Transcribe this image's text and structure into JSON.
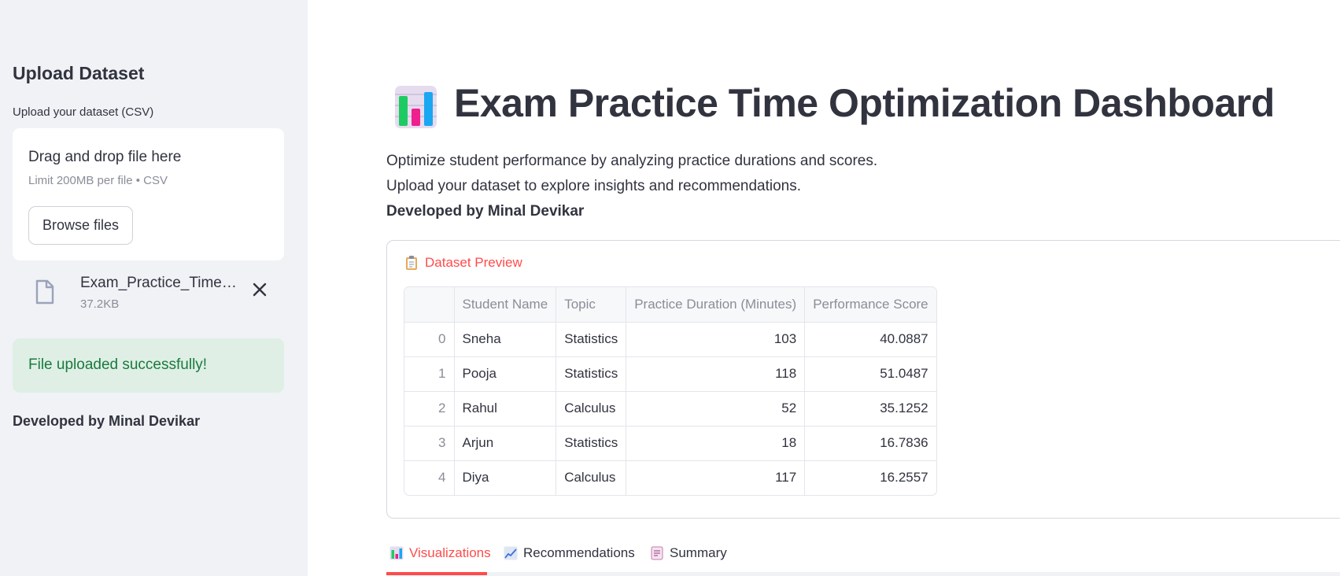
{
  "sidebar": {
    "title": "Upload Dataset",
    "upload_label": "Upload your dataset (CSV)",
    "dropzone_title": "Drag and drop file here",
    "dropzone_limit": "Limit 200MB per file • CSV",
    "browse_label": "Browse files",
    "file_name": "Exam_Practice_Time_Optimization.csv",
    "file_size": "37.2KB",
    "success_message": "File uploaded successfully!",
    "developer": "Developed by Minal Devikar"
  },
  "header": {
    "title": "Exam Practice Time Optimization Dashboard",
    "title_icon": "bar-chart-icon"
  },
  "intro": {
    "line1": "Optimize student performance by analyzing practice durations and scores.",
    "line2": "Upload your dataset to explore insights and recommendations.",
    "developer": "Developed by Minal Devikar"
  },
  "preview": {
    "title": "Dataset Preview",
    "icon": "clipboard-icon",
    "columns": [
      "",
      "Student Name",
      "Topic",
      "Practice Duration (Minutes)",
      "Performance Score"
    ],
    "rows": [
      [
        "0",
        "Sneha",
        "Statistics",
        "103",
        "40.0887"
      ],
      [
        "1",
        "Pooja",
        "Statistics",
        "118",
        "51.0487"
      ],
      [
        "2",
        "Rahul",
        "Calculus",
        "52",
        "35.1252"
      ],
      [
        "3",
        "Arjun",
        "Statistics",
        "18",
        "16.7836"
      ],
      [
        "4",
        "Diya",
        "Calculus",
        "117",
        "16.2557"
      ]
    ]
  },
  "tabs": [
    {
      "label": "Visualizations",
      "icon": "bar-chart-icon",
      "active": true
    },
    {
      "label": "Recommendations",
      "icon": "line-chart-icon",
      "active": false
    },
    {
      "label": "Summary",
      "icon": "document-icon",
      "active": false
    }
  ],
  "colors": {
    "accent": "#ff4b4b",
    "sidebar_bg": "#f0f2f6",
    "success_bg": "#dfefe6",
    "success_text": "#1a7a3c",
    "text": "#31333f"
  }
}
